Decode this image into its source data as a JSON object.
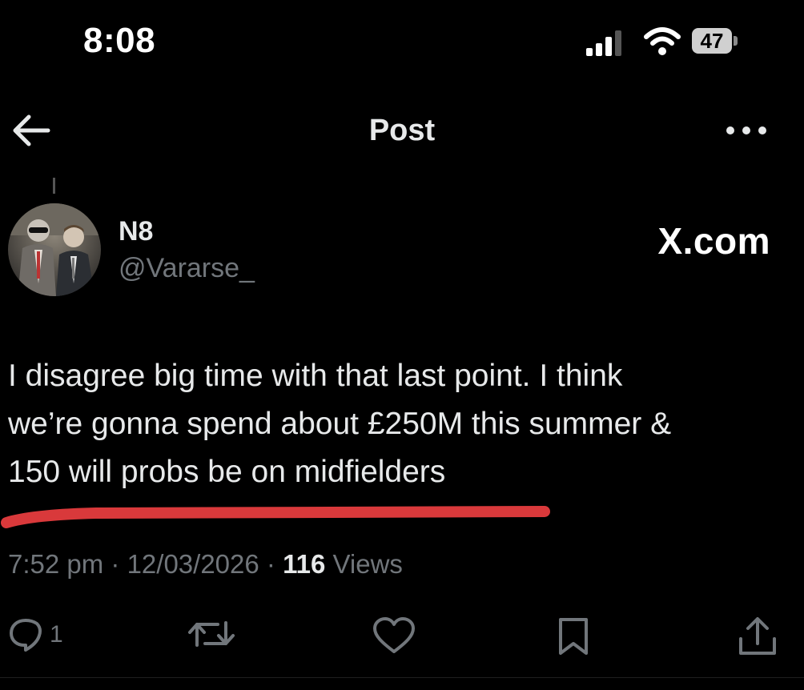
{
  "status_bar": {
    "time": "8:08",
    "battery": "47",
    "icons": [
      "cellular-signal-icon",
      "wifi-icon",
      "battery-icon"
    ]
  },
  "header": {
    "title": "Post",
    "back_icon": "arrow-left-icon",
    "more_icon": "ellipsis-icon"
  },
  "post": {
    "author": {
      "display_name": "N8",
      "handle": "@Vararse_"
    },
    "brand_label": "X.com",
    "text": "I disagree big time with that last point. I think\nwe’re gonna spend about £250M this summer &\n150 will probs be on midfielders",
    "timestamp": "7:52 pm · 12/03/2026 · ",
    "views_count": "116",
    "views_label": " Views",
    "highlight_color": "#d9393b",
    "actions": {
      "reply_count": "1",
      "icons": [
        "reply-icon",
        "repost-icon",
        "like-icon",
        "bookmark-icon",
        "share-icon"
      ]
    }
  },
  "colors": {
    "background": "#000000",
    "text_primary": "#e7e9ea",
    "text_secondary": "#71767b"
  }
}
